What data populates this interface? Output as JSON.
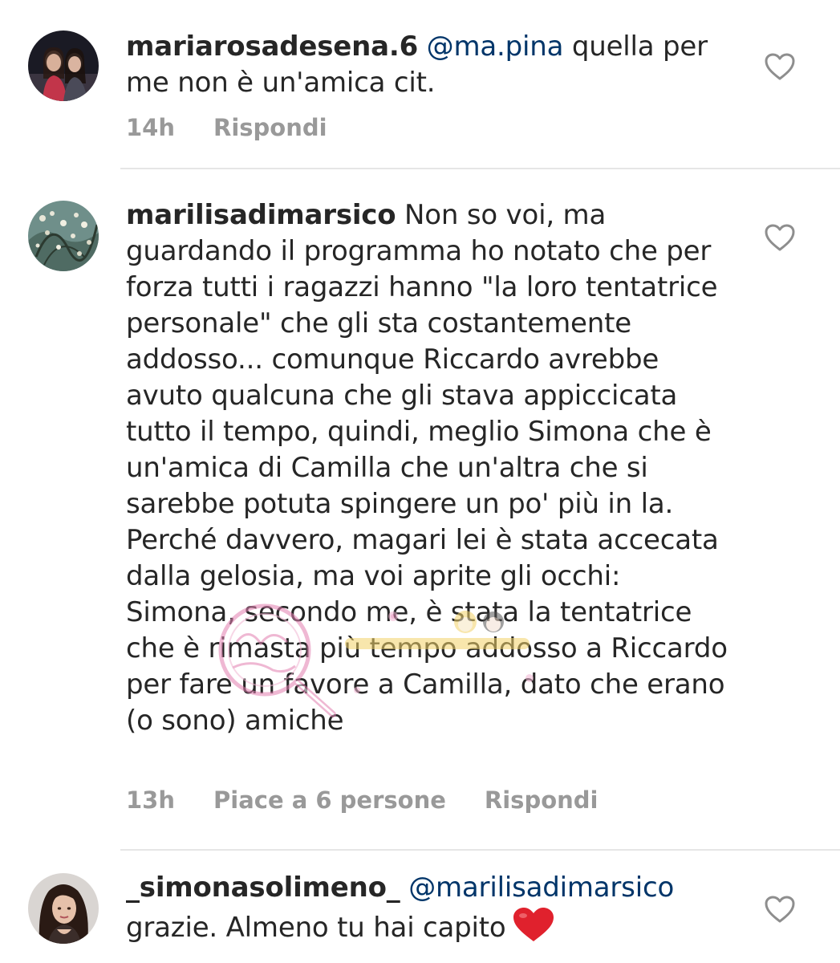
{
  "comments": [
    {
      "username": "mariarosadesena.6",
      "mention": "@ma.pina",
      "text": "quella per me non è un'amica cit.",
      "time": "14h",
      "likes": "",
      "reply_label": "Rispondi"
    },
    {
      "username": "marilisadimarsico",
      "text": "Non so voi, ma guardando il programma ho notato che per forza tutti i ragazzi hanno \"la loro tentatrice personale\" che gli sta costantemente addosso... comunque Riccardo avrebbe avuto qualcuna che gli stava appiccicata tutto il tempo, quindi, meglio Simona che è un'amica di Camilla che un'altra che si sarebbe potuta spingere un po' più in la. Perché davvero, magari lei è stata accecata dalla gelosia, ma voi aprite gli occhi: Simona, secondo me, è stata la tentatrice che è rimasta più tempo addosso a Riccardo per fare un favore a Camilla, dato che erano (o sono) amiche",
      "time": "13h",
      "likes": "Piace a 6 persone",
      "reply_label": "Rispondi"
    },
    {
      "username": "_simonasolimeno_",
      "mention": "@marilisadimarsico",
      "text": "grazie. Almeno tu hai capito",
      "emoji": "red-heart"
    }
  ],
  "colors": {
    "username": "#262626",
    "mention": "#003569",
    "meta": "#999999",
    "heart_emoji": "#e0212d"
  }
}
